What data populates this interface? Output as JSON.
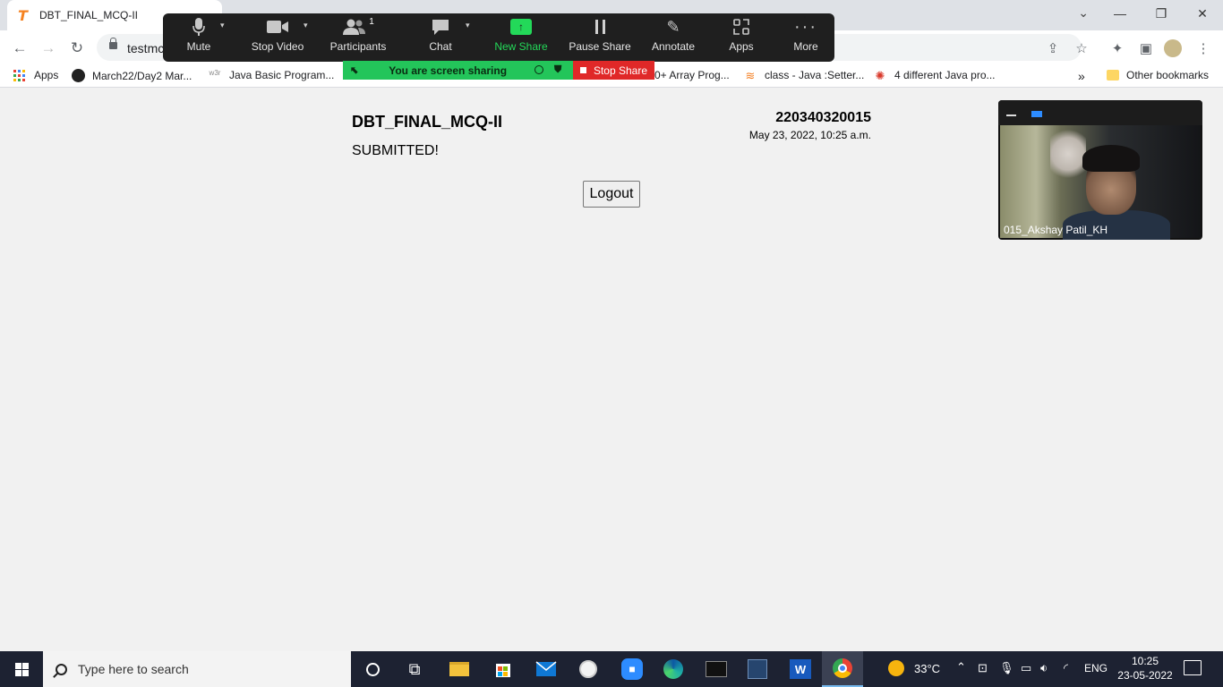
{
  "browser": {
    "tab_title": "DBT_FINAL_MCQ-II",
    "url_partial": "testmc",
    "window_controls": {
      "minimize": "—",
      "restore": "❐",
      "close": "✕"
    }
  },
  "bookmarks": {
    "items": [
      {
        "label": "Apps"
      },
      {
        "label": "March22/Day2 Mar..."
      },
      {
        "label": "Java Basic Program..."
      },
      {
        "label": "0+ Array Prog..."
      },
      {
        "label": "class - Java :Setter..."
      },
      {
        "label": "4 different Java pro..."
      }
    ],
    "overflow": "»",
    "other": "Other bookmarks"
  },
  "page": {
    "title": "DBT_FINAL_MCQ-II",
    "status": "SUBMITTED!",
    "user_id": "220340320015",
    "datetime": "May 23, 2022, 10:25 a.m.",
    "logout_label": "Logout"
  },
  "zoom_toolbar": {
    "items": [
      {
        "label": "Mute"
      },
      {
        "label": "Stop Video"
      },
      {
        "label": "Participants",
        "count": "1"
      },
      {
        "label": "Chat"
      },
      {
        "label": "New Share"
      },
      {
        "label": "Pause Share"
      },
      {
        "label": "Annotate"
      },
      {
        "label": "Apps"
      },
      {
        "label": "More"
      }
    ],
    "sharing_banner": "You are screen sharing",
    "stop_share": "Stop Share",
    "accent_green": "#23d959",
    "stop_red": "#e02828"
  },
  "video": {
    "participant_name": "015_Akshay Patil_KH"
  },
  "taskbar": {
    "search_placeholder": "Type here to search",
    "weather": "33°C",
    "language": "ENG",
    "time": "10:25",
    "date": "23-05-2022"
  }
}
